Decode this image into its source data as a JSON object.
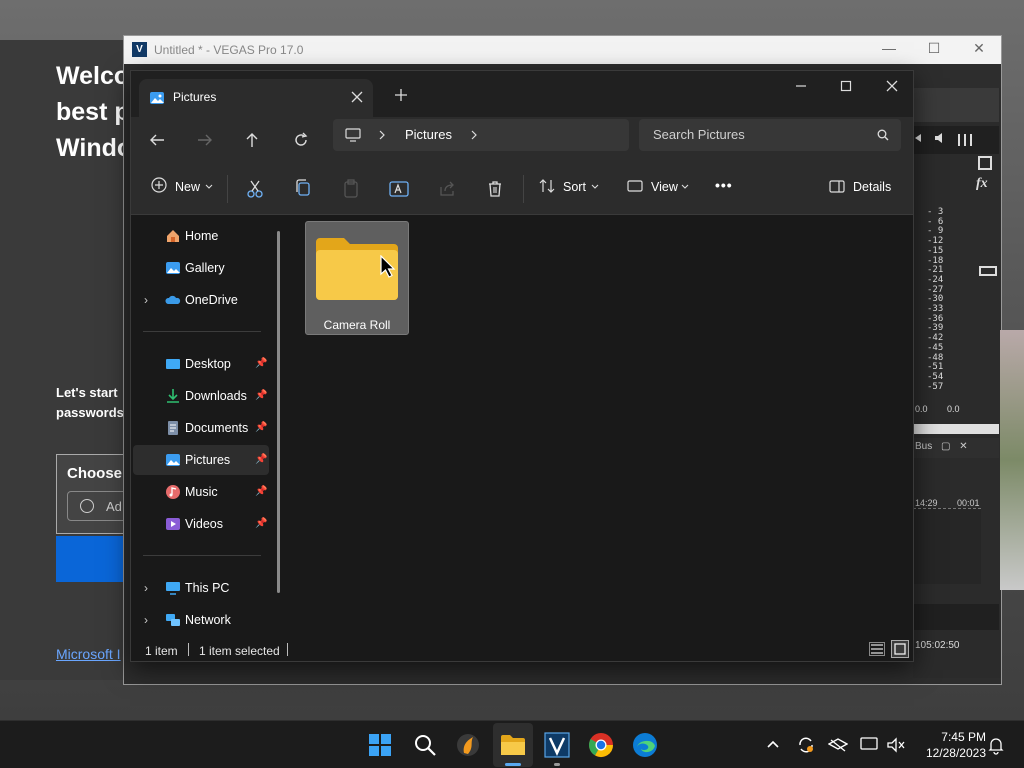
{
  "desktop": {
    "welcome": {
      "line1": "Welco",
      "line2": "best p",
      "line3": "Windo",
      "sub1": "Let's start",
      "sub2": "passwords",
      "choose": "Choose",
      "add": "Ad",
      "link": "Microsoft I"
    }
  },
  "vegas": {
    "title": "Untitled * - VEGAS Pro 17.0",
    "logo": "V",
    "meter": [
      "- 3",
      "- 6",
      "- 9",
      "-12",
      "-15",
      "-18",
      "-21",
      "-24",
      "-27",
      "-30",
      "-33",
      "-36",
      "-39",
      "-42",
      "-45",
      "-48",
      "-51",
      "-54",
      "-57"
    ],
    "meter_values": [
      "0.0",
      "0.0"
    ],
    "bus": "Bus",
    "time1": "14:29",
    "time2": "00:01",
    "timecode": "105:02:50",
    "fx": "fx"
  },
  "explorer": {
    "tab_title": "Pictures",
    "breadcrumb": {
      "item": "Pictures"
    },
    "search": {
      "placeholder": "Search Pictures"
    },
    "toolbar": {
      "new": "New",
      "sort": "Sort",
      "view": "View",
      "more": "•••",
      "details": "Details"
    },
    "nav": {
      "top": [
        {
          "label": "Home",
          "icon": "home-icon"
        },
        {
          "label": "Gallery",
          "icon": "gallery-icon"
        },
        {
          "label": "OneDrive",
          "icon": "onedrive-icon"
        }
      ],
      "pinned": [
        {
          "label": "Desktop",
          "icon": "desktop-icon"
        },
        {
          "label": "Downloads",
          "icon": "downloads-icon"
        },
        {
          "label": "Documents",
          "icon": "documents-icon"
        },
        {
          "label": "Pictures",
          "icon": "pictures-icon",
          "selected": true
        },
        {
          "label": "Music",
          "icon": "music-icon"
        },
        {
          "label": "Videos",
          "icon": "videos-icon"
        }
      ],
      "bottom": [
        {
          "label": "This PC",
          "icon": "this-pc-icon"
        },
        {
          "label": "Network",
          "icon": "network-icon"
        }
      ]
    },
    "items": [
      {
        "name": "Camera Roll",
        "type": "folder",
        "selected": true
      }
    ],
    "status": {
      "count": "1 item",
      "selected": "1 item selected"
    }
  },
  "taskbar": {
    "time": "7:45 PM",
    "date": "12/28/2023"
  },
  "colors": {
    "accent": "#0a66d8",
    "folder": "#f7c948",
    "selected_bg": "#5f5f5f",
    "nav_selected": "#2d2d2d"
  }
}
